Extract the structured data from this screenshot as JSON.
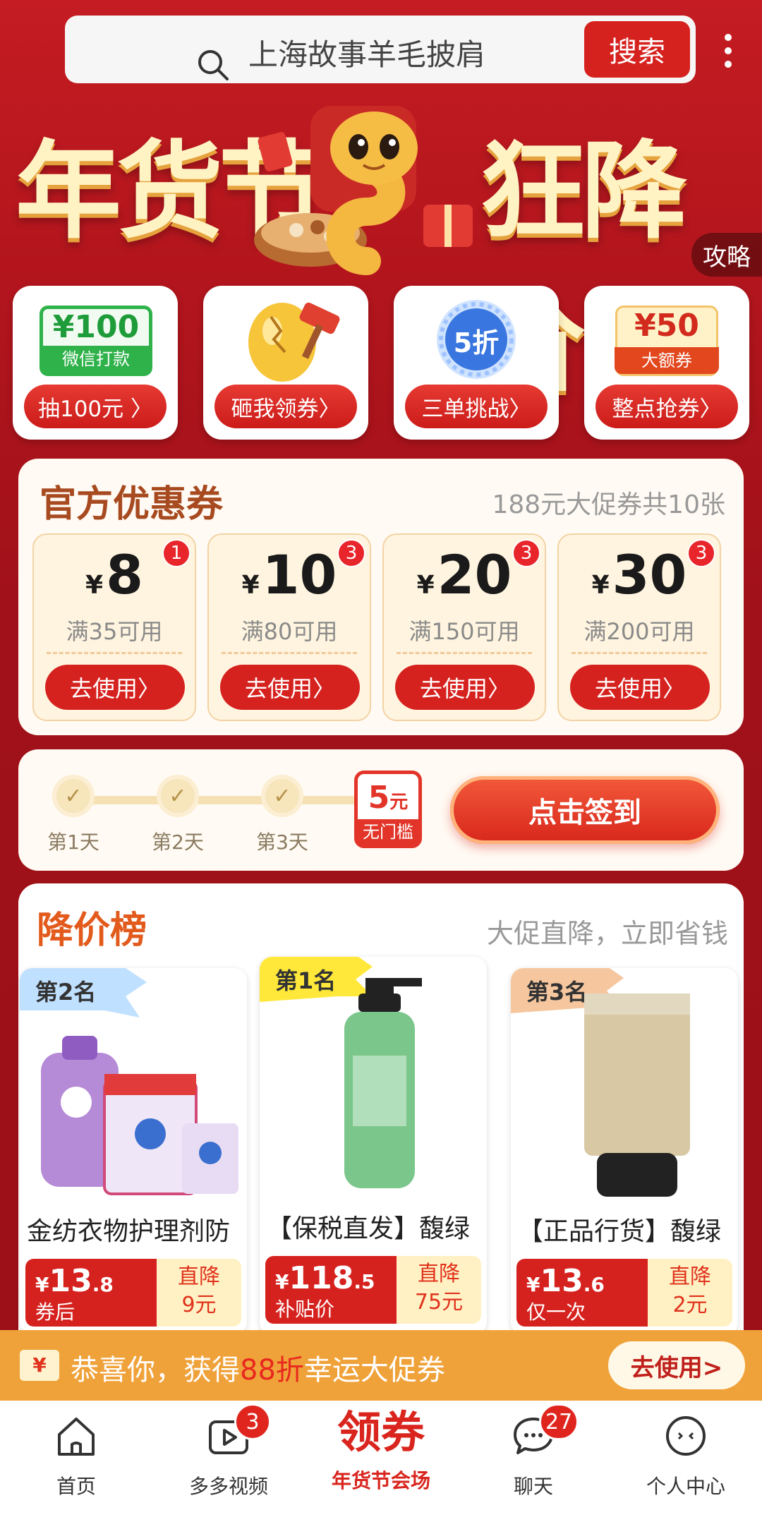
{
  "search": {
    "query": "上海故事羊毛披肩",
    "button": "搜索"
  },
  "banner": {
    "left_title": "年货节",
    "right_title": "狂降价",
    "guide": "攻略"
  },
  "entries": [
    {
      "art_amount": "¥100",
      "art_sub": "微信打款",
      "label": "抽100元 〉"
    },
    {
      "label": "砸我领券〉"
    },
    {
      "art_text": "5折",
      "label": "三单挑战〉"
    },
    {
      "art_amount": "¥50",
      "art_sub": "大额券",
      "label": "整点抢券〉"
    }
  ],
  "coupons": {
    "title": "官方优惠券",
    "subtitle": "188元大促券共10张",
    "items": [
      {
        "yen": "¥",
        "amount": "8",
        "cond": "满35可用",
        "count": "1",
        "btn": "去使用〉"
      },
      {
        "yen": "¥",
        "amount": "10",
        "cond": "满80可用",
        "count": "3",
        "btn": "去使用〉"
      },
      {
        "yen": "¥",
        "amount": "20",
        "cond": "满150可用",
        "count": "3",
        "btn": "去使用〉"
      },
      {
        "yen": "¥",
        "amount": "30",
        "cond": "满200可用",
        "count": "3",
        "btn": "去使用〉"
      }
    ]
  },
  "signin": {
    "days": [
      "第1天",
      "第2天",
      "第3天"
    ],
    "reward_value": "5",
    "reward_unit": "元",
    "reward_label": "无门槛",
    "button": "点击签到"
  },
  "ranking": {
    "title": "降价榜",
    "subtitle": "大促直降，立即省钱",
    "items": [
      {
        "rank": "第2名",
        "name": "金纺衣物护理剂防",
        "yen": "¥",
        "price_int": "13",
        "price_dec": ".8",
        "note": "券后",
        "drop_label": "直降",
        "drop_value": "9元"
      },
      {
        "rank": "第1名",
        "name": "【保税直发】馥绿",
        "yen": "¥",
        "price_int": "118",
        "price_dec": ".5",
        "note": "补贴价",
        "drop_label": "直降",
        "drop_value": "75元"
      },
      {
        "rank": "第3名",
        "name": "【正品行货】馥绿",
        "yen": "¥",
        "price_int": "13",
        "price_dec": ".6",
        "note": "仅一次",
        "drop_label": "直降",
        "drop_value": "2元"
      }
    ]
  },
  "toast": {
    "icon": "¥",
    "pre": "恭喜你，获得",
    "highlight": "88折",
    "post": "幸运大促券",
    "button": "去使用>"
  },
  "tabbar": {
    "items": [
      {
        "label": "首页"
      },
      {
        "label": "多多视频",
        "badge": "3"
      },
      {
        "big": "领券",
        "label": "年货节会场"
      },
      {
        "label": "聊天",
        "badge": "27"
      },
      {
        "label": "个人中心"
      }
    ]
  },
  "colors": {
    "brand_red": "#d6221f",
    "panel_bg": "#fffaf3",
    "gold": "#fff3c4"
  }
}
